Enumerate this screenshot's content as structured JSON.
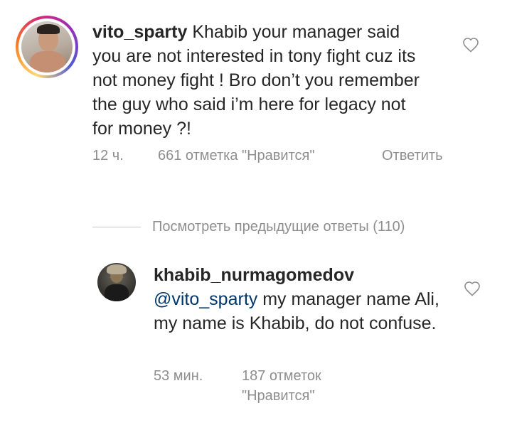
{
  "comment1": {
    "username": "vito_sparty",
    "text": "Khabib your manager said you are not interested in tony fight cuz its not money fight ! Bro don’t you remember  the guy who said i’m here for legacy not for money ?!",
    "time": "12 ч.",
    "likes": "661 отметка \"Нравится\"",
    "reply_label": "Ответить"
  },
  "view_previous_replies": "Посмотреть предыдущие ответы (110)",
  "comment2": {
    "username": "khabib_nurmagomedov",
    "mention": "@vito_sparty",
    "text": " my manager name Ali, my name is Khabib, do not confuse.",
    "time": "53 мин.",
    "likes_line1": "187 отметок",
    "likes_line2": "\"Нравится\""
  },
  "icons": {
    "heart": "heart-outline-icon"
  },
  "colors": {
    "text": "#262626",
    "muted": "#8e8e8e",
    "mention": "#00376b"
  }
}
